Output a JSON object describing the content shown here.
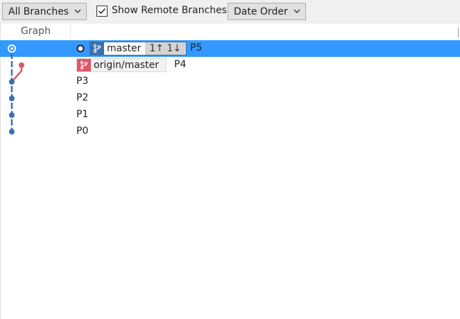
{
  "toolbar": {
    "branch_filter": "All Branches",
    "show_remote_label": "Show Remote Branches",
    "show_remote_checked": true,
    "order": "Date Order"
  },
  "columns": {
    "graph": "Graph"
  },
  "commits": [
    {
      "message": "P5",
      "selected": true,
      "branch": "master",
      "ahead_behind": "1↑ 1↓"
    },
    {
      "message": "P4",
      "selected": false,
      "branch": "origin/master"
    },
    {
      "message": "P3",
      "selected": false
    },
    {
      "message": "P2",
      "selected": false
    },
    {
      "message": "P1",
      "selected": false
    },
    {
      "message": "P0",
      "selected": false
    }
  ],
  "colors": {
    "selection": "#3399ff",
    "local_branch": "#3a6fb0",
    "remote_branch": "#e0566a"
  }
}
